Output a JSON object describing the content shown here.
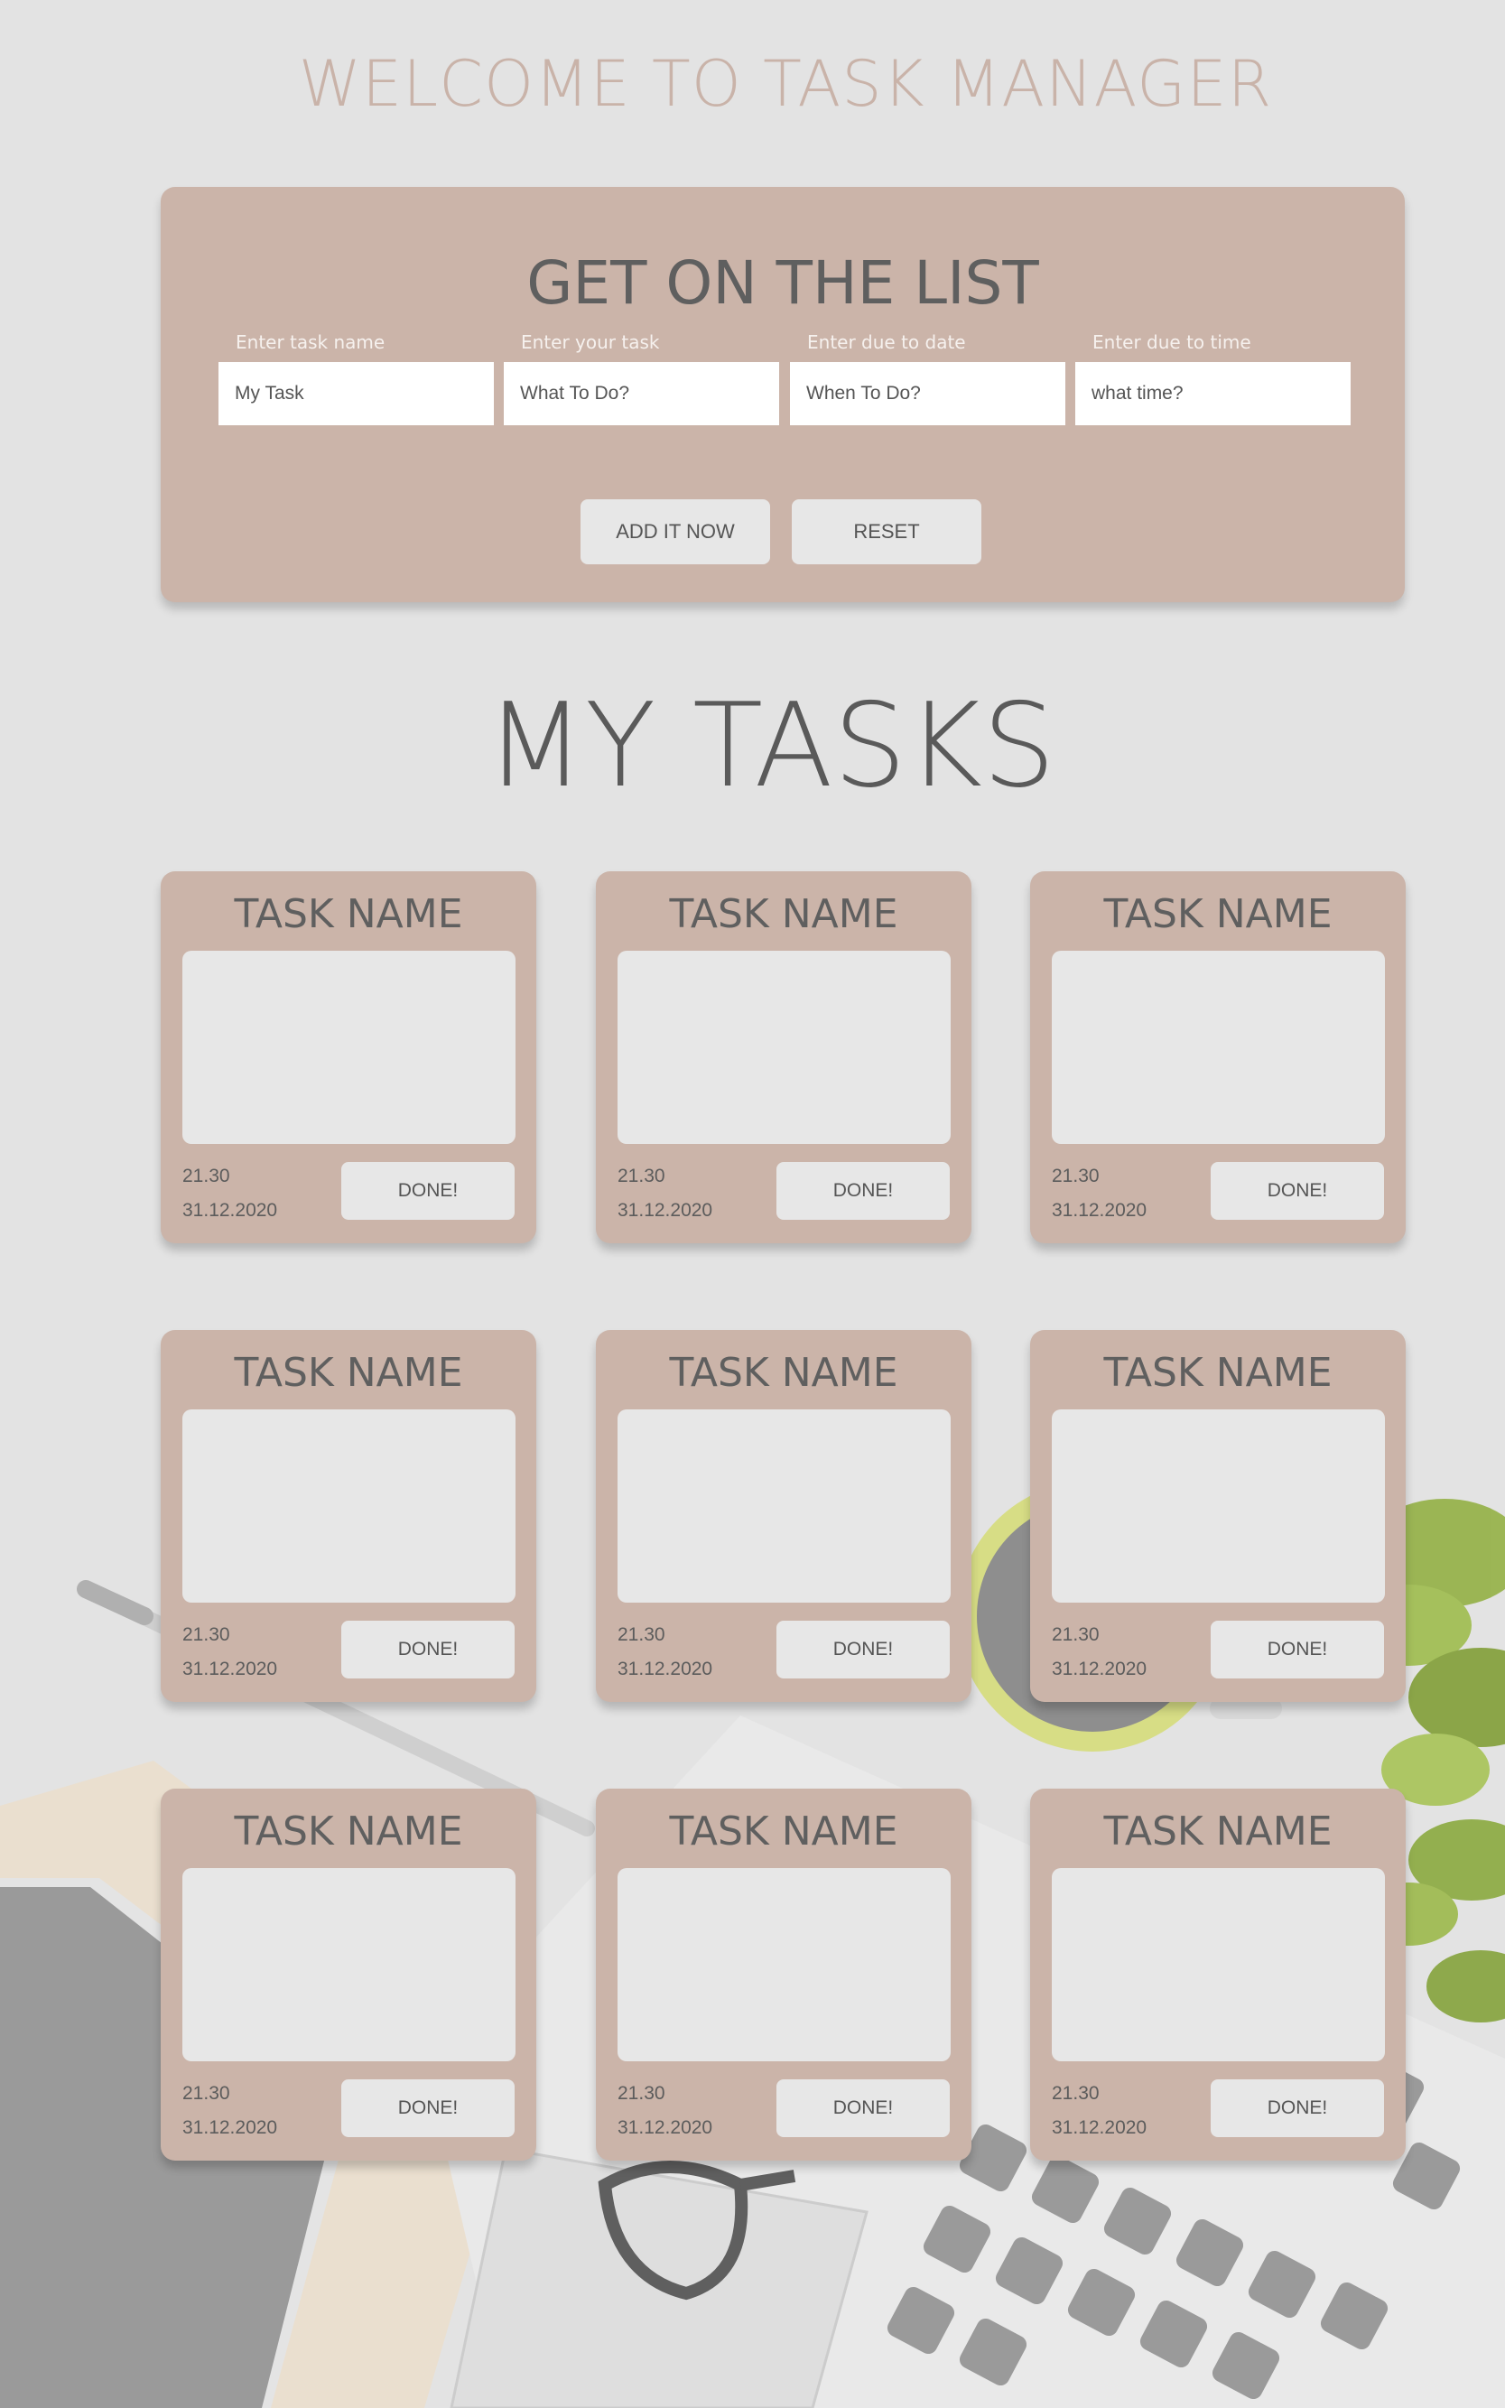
{
  "page": {
    "title": "WELCOME TO TASK MANAGER"
  },
  "form": {
    "title": "GET ON THE LIST",
    "fields": [
      {
        "label": "Enter task name",
        "placeholder": "My Task"
      },
      {
        "label": "Enter your task",
        "placeholder": "What To Do?"
      },
      {
        "label": "Enter due to date",
        "placeholder": "When To Do?"
      },
      {
        "label": "Enter due to time",
        "placeholder": "what time?"
      }
    ],
    "add_label": "ADD IT NOW",
    "reset_label": "RESET"
  },
  "tasks": {
    "heading": "MY TASKS",
    "items": [
      {
        "name": "TASK NAME",
        "time": "21.30",
        "date": "31.12.2020",
        "done_label": "DONE!"
      },
      {
        "name": "TASK NAME",
        "time": "21.30",
        "date": "31.12.2020",
        "done_label": "DONE!"
      },
      {
        "name": "TASK NAME",
        "time": "21.30",
        "date": "31.12.2020",
        "done_label": "DONE!"
      },
      {
        "name": "TASK NAME",
        "time": "21.30",
        "date": "31.12.2020",
        "done_label": "DONE!"
      },
      {
        "name": "TASK NAME",
        "time": "21.30",
        "date": "31.12.2020",
        "done_label": "DONE!"
      },
      {
        "name": "TASK NAME",
        "time": "21.30",
        "date": "31.12.2020",
        "done_label": "DONE!"
      },
      {
        "name": "TASK NAME",
        "time": "21.30",
        "date": "31.12.2020",
        "done_label": "DONE!"
      },
      {
        "name": "TASK NAME",
        "time": "21.30",
        "date": "31.12.2020",
        "done_label": "DONE!"
      },
      {
        "name": "TASK NAME",
        "time": "21.30",
        "date": "31.12.2020",
        "done_label": "DONE!"
      }
    ]
  },
  "colors": {
    "background": "#e3e3e3",
    "panel": "#cbb4a9",
    "title_accent": "#c9b3a9",
    "heading_text": "#5a5a5a",
    "button_bg": "#e7e7e7"
  }
}
